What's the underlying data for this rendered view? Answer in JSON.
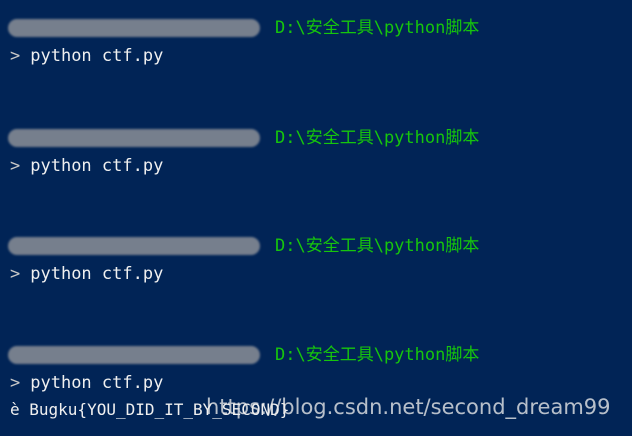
{
  "terminal": {
    "blocks": [
      {
        "path": "D:\\安全工具\\python脚本",
        "prompt": ">",
        "command": "python ctf.py"
      },
      {
        "path": "D:\\安全工具\\python脚本",
        "prompt": ">",
        "command": "python ctf.py"
      },
      {
        "path": "D:\\安全工具\\python脚本",
        "prompt": ">",
        "command": "python ctf.py"
      },
      {
        "path": "D:\\安全工具\\python脚本",
        "prompt": ">",
        "command": "python ctf.py"
      }
    ],
    "output": "è Bugku{YOU_DID_IT_BY_SECOND}"
  },
  "watermark": "https://blog.csdn.net/second_dream99",
  "colors": {
    "background": "#012456",
    "path": "#16c60c",
    "text": "#f0f0f0"
  }
}
